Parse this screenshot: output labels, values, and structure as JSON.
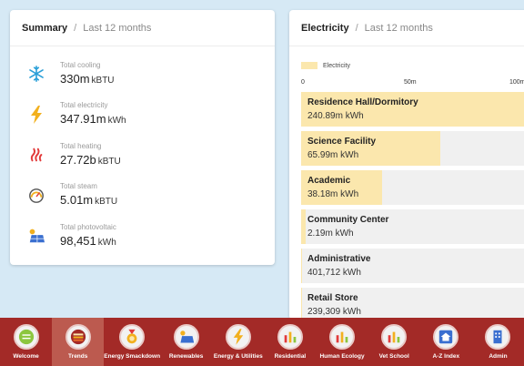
{
  "summary": {
    "title": "Summary",
    "separator": "/",
    "subtitle": "Last 12 months",
    "items": [
      {
        "label": "Total cooling",
        "value": "330m",
        "unit": "kBTU",
        "icon": "snowflake-icon",
        "color": "#2a9fd8"
      },
      {
        "label": "Total electricity",
        "value": "347.91m",
        "unit": "kWh",
        "icon": "lightning-icon",
        "color": "#f2b01e"
      },
      {
        "label": "Total heating",
        "value": "27.72b",
        "unit": "kBTU",
        "icon": "heating-icon",
        "color": "#e23b3b"
      },
      {
        "label": "Total steam",
        "value": "5.01m",
        "unit": "kBTU",
        "icon": "steam-gauge-icon",
        "color": "#555555"
      },
      {
        "label": "Total photovoltaic",
        "value": "98,451",
        "unit": "kWh",
        "icon": "solar-panel-icon",
        "color": "#3a6fd0"
      }
    ]
  },
  "electricity": {
    "title": "Electricity",
    "separator": "/",
    "subtitle": "Last 12 months",
    "legend": "Electricity",
    "axis_ticks": [
      "0",
      "50m",
      "100m"
    ]
  },
  "chart_data": {
    "type": "bar",
    "categories": [
      "Residence Hall/Dormitory",
      "Science Facility",
      "Academic",
      "Community Center",
      "Administrative",
      "Retail Store"
    ],
    "values": [
      240890000,
      65990000,
      38180000,
      2190000,
      401712,
      239309
    ],
    "value_labels": [
      "240.89m kWh",
      "65.99m kWh",
      "38.18m kWh",
      "2.19m kWh",
      "401,712 kWh",
      "239,309 kWh"
    ],
    "series": [
      {
        "name": "Electricity",
        "color": "#fbe7ad"
      }
    ],
    "xlim": [
      0,
      100000000
    ]
  },
  "nav": {
    "items": [
      {
        "label": "Welcome",
        "icon": "chat-bubble-icon",
        "active": false
      },
      {
        "label": "Trends",
        "icon": "trends-icon",
        "active": true
      },
      {
        "label": "Energy Smackdown",
        "icon": "medal-icon",
        "active": false
      },
      {
        "label": "Renewables",
        "icon": "solar-panel-icon",
        "active": false
      },
      {
        "label": "Energy & Utilities",
        "icon": "lightning-icon",
        "active": false
      },
      {
        "label": "Residential",
        "icon": "bar-chart-icon",
        "active": false
      },
      {
        "label": "Human Ecology",
        "icon": "bar-chart-icon",
        "active": false
      },
      {
        "label": "Vet School",
        "icon": "bar-chart-icon",
        "active": false
      },
      {
        "label": "A-Z Index",
        "icon": "house-icon",
        "active": false
      },
      {
        "label": "Admin",
        "icon": "building-icon",
        "active": false
      }
    ]
  }
}
